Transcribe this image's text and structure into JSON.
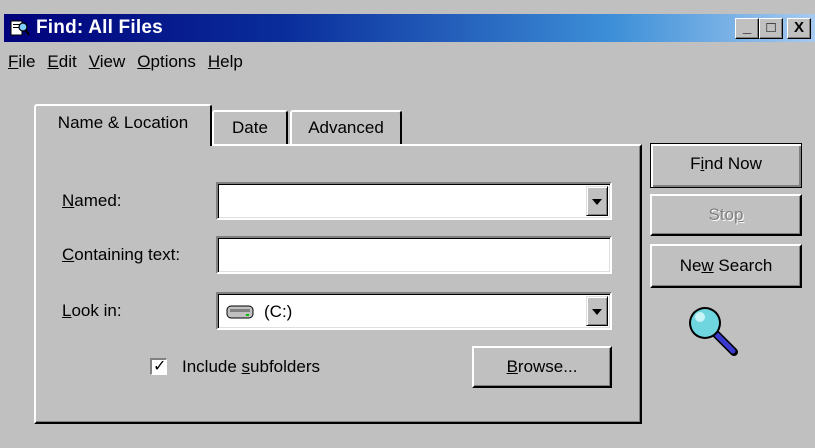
{
  "window": {
    "title": "Find: All Files",
    "controls": {
      "minimize": "_",
      "maximize": "□",
      "close": "X"
    }
  },
  "menu": {
    "file": {
      "first": "F",
      "rest": "ile"
    },
    "edit": {
      "first": "E",
      "rest": "dit"
    },
    "view": {
      "first": "V",
      "rest": "iew"
    },
    "options": {
      "first": "O",
      "rest": "ptions"
    },
    "help": {
      "first": "H",
      "rest": "elp"
    }
  },
  "tabs": {
    "name_location": "Name & Location",
    "date": "Date",
    "advanced": "Advanced",
    "active": "Name & Location"
  },
  "form": {
    "named": {
      "first": "N",
      "rest": "amed:",
      "value": ""
    },
    "containing_text": {
      "first": "C",
      "rest": "ontaining text:",
      "value": ""
    },
    "look_in": {
      "first": "L",
      "rest": "ook in:",
      "value": "(C:)",
      "icon": "hard-drive-icon"
    },
    "include_subfolders": {
      "pre": "Include ",
      "accel": "s",
      "post": "ubfolders",
      "checked": true,
      "mark": "✓"
    }
  },
  "buttons": {
    "browse": {
      "first": "B",
      "rest": "rowse..."
    },
    "find_now": {
      "pre": "F",
      "accel": "i",
      "post": "nd Now"
    },
    "stop": {
      "pre": "Sto",
      "accel": "p",
      "post": "",
      "enabled": false
    },
    "new_search": {
      "pre": "Ne",
      "accel": "w",
      "post": " Search"
    }
  },
  "icons": {
    "app": "find-files-icon",
    "animation": "magnifier-icon"
  },
  "colors": {
    "face": "#c0c0c0",
    "title_gradient_start": "#00007b",
    "title_gradient_end": "#a6caf0",
    "disabled_text": "#808080",
    "magnifier_glass": "#6fd6df"
  }
}
